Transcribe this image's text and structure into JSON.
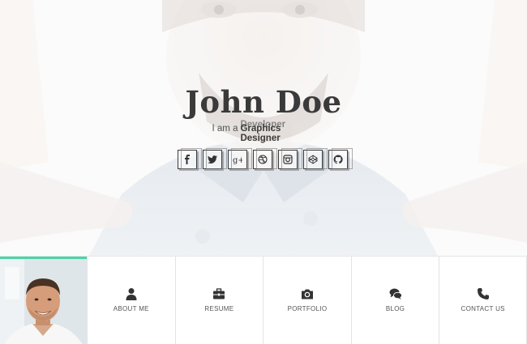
{
  "hero": {
    "name": "John Doe",
    "tagline_prefix": "I am a",
    "role_current": "Graphics Designer",
    "role_fading": "Developer"
  },
  "socials": [
    {
      "icon": "facebook-icon",
      "glyph": "f"
    },
    {
      "icon": "twitter-icon"
    },
    {
      "icon": "google-plus-icon",
      "glyph": "g+"
    },
    {
      "icon": "dribbble-icon"
    },
    {
      "icon": "instagram-icon"
    },
    {
      "icon": "codepen-icon"
    },
    {
      "icon": "github-icon"
    }
  ],
  "nav": [
    {
      "label": "ABOUT ME",
      "icon": "user-icon"
    },
    {
      "label": "RESUME",
      "icon": "briefcase-icon"
    },
    {
      "label": "PORTFOLIO",
      "icon": "camera-icon"
    },
    {
      "label": "BLOG",
      "icon": "comments-icon"
    },
    {
      "label": "CONTACT US",
      "icon": "phone-icon"
    }
  ],
  "colors": {
    "accent": "#48d6a8",
    "text_dark": "#3a3a3a",
    "border": "#e3e3e3"
  }
}
